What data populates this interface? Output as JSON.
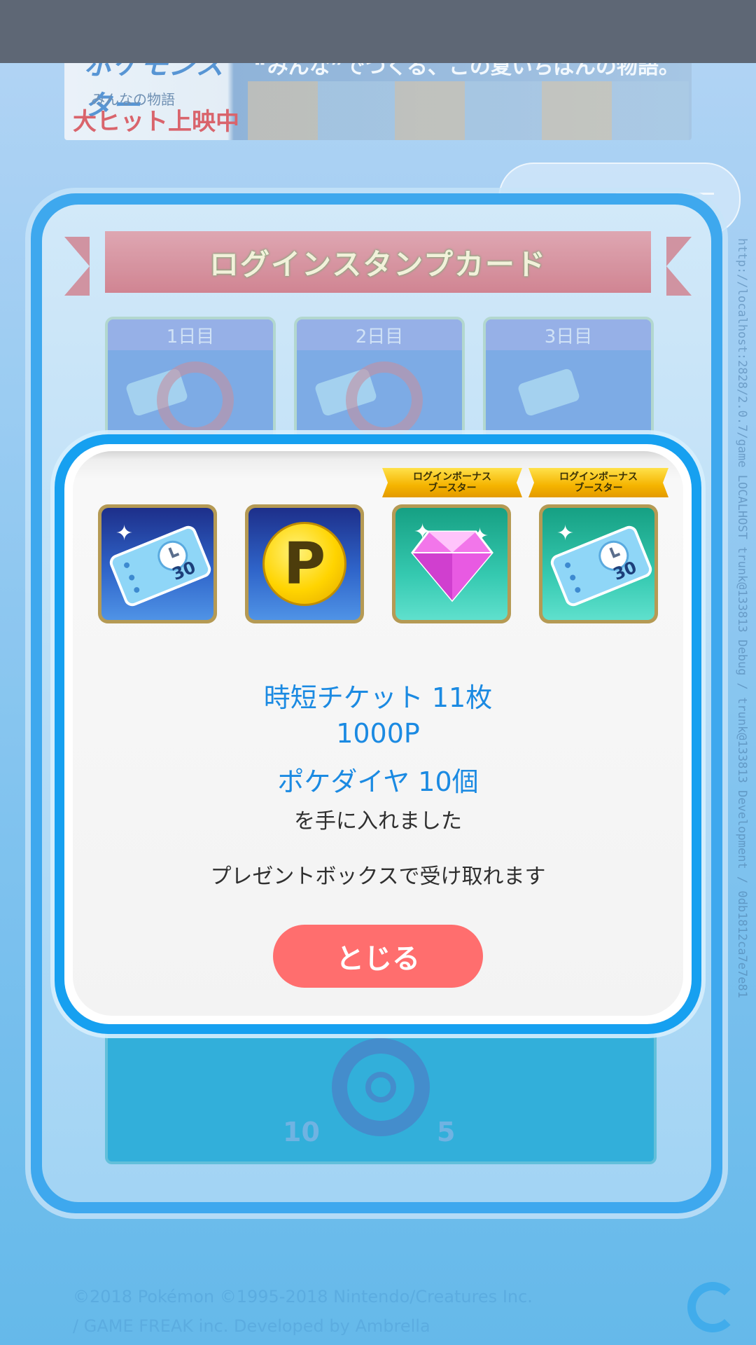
{
  "banner": {
    "logo": "ポケモンスター",
    "subtitle": "みんなの物語",
    "status": "大ヒット上映中",
    "catchphrase": "“みんな”でつくる、この夏いちばんの物語。"
  },
  "side_debug_text": "http://localhost:2828/2.0.7/game LOCALHOST trunk@133813 Debug / trunk@133813 Development / 0db1812ca7e7e81",
  "stamp_card": {
    "title": "ログインスタンプカード",
    "days": [
      {
        "label": "1日目"
      },
      {
        "label": "2日目"
      },
      {
        "label": "3日目"
      }
    ],
    "bottom_values": [
      "10",
      "5"
    ]
  },
  "modal": {
    "badges": [
      {
        "line1": "ログインボーナス",
        "line2": "ブースター"
      },
      {
        "line1": "ログインボーナス",
        "line2": "ブースター"
      }
    ],
    "items": [
      {
        "icon": "time-ticket-icon",
        "label_30": "30",
        "background": "#2f64c9"
      },
      {
        "icon": "coin-p-icon",
        "glyph": "P",
        "background": "#2f64c9"
      },
      {
        "icon": "diamond-gem-icon",
        "background": "#35c9b0"
      },
      {
        "icon": "time-ticket-icon",
        "label_30": "30",
        "background": "#35c9b0"
      }
    ],
    "reward_lines": [
      "時短チケット 11枚",
      "1000P",
      "ポケダイヤ 10個"
    ],
    "obtained_text": "を手に入れました",
    "present_box_text": "プレゼントボックスで受け取れます",
    "close_label": "とじる"
  },
  "copyright": {
    "line1": "©2018 Pokémon ©1995-2018 Nintendo/Creatures Inc.",
    "line2": "/ GAME FREAK inc. Developed by Ambrella"
  },
  "colors": {
    "modal_border": "#16a0f0",
    "reward_text": "#1b8ae2",
    "close_button": "#ff6e6e",
    "badge_gold": "#f5b400"
  }
}
